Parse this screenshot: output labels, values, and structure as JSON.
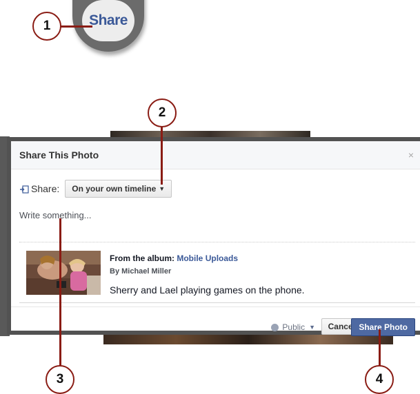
{
  "zoom": {
    "share_link": "Share"
  },
  "callouts": [
    {
      "number": "1"
    },
    {
      "number": "2"
    },
    {
      "number": "3"
    },
    {
      "number": "4"
    }
  ],
  "dialog": {
    "title": "Share This Photo",
    "close_glyph": "×",
    "share_label": "Share:",
    "share_target": "On your own timeline",
    "caret": "▼",
    "write_placeholder": "Write something...",
    "album_prefix": "From the album:",
    "album_name": "Mobile Uploads",
    "byline": "By Michael Miller",
    "caption": "Sherry and Lael playing games on the phone.",
    "privacy": "Public",
    "cancel_label": "Cancel",
    "share_button_label": "Share Photo"
  },
  "colors": {
    "callout_border": "#8a1c14",
    "facebook_blue": "#3b5998",
    "share_button_bg": "#4e69a2"
  }
}
